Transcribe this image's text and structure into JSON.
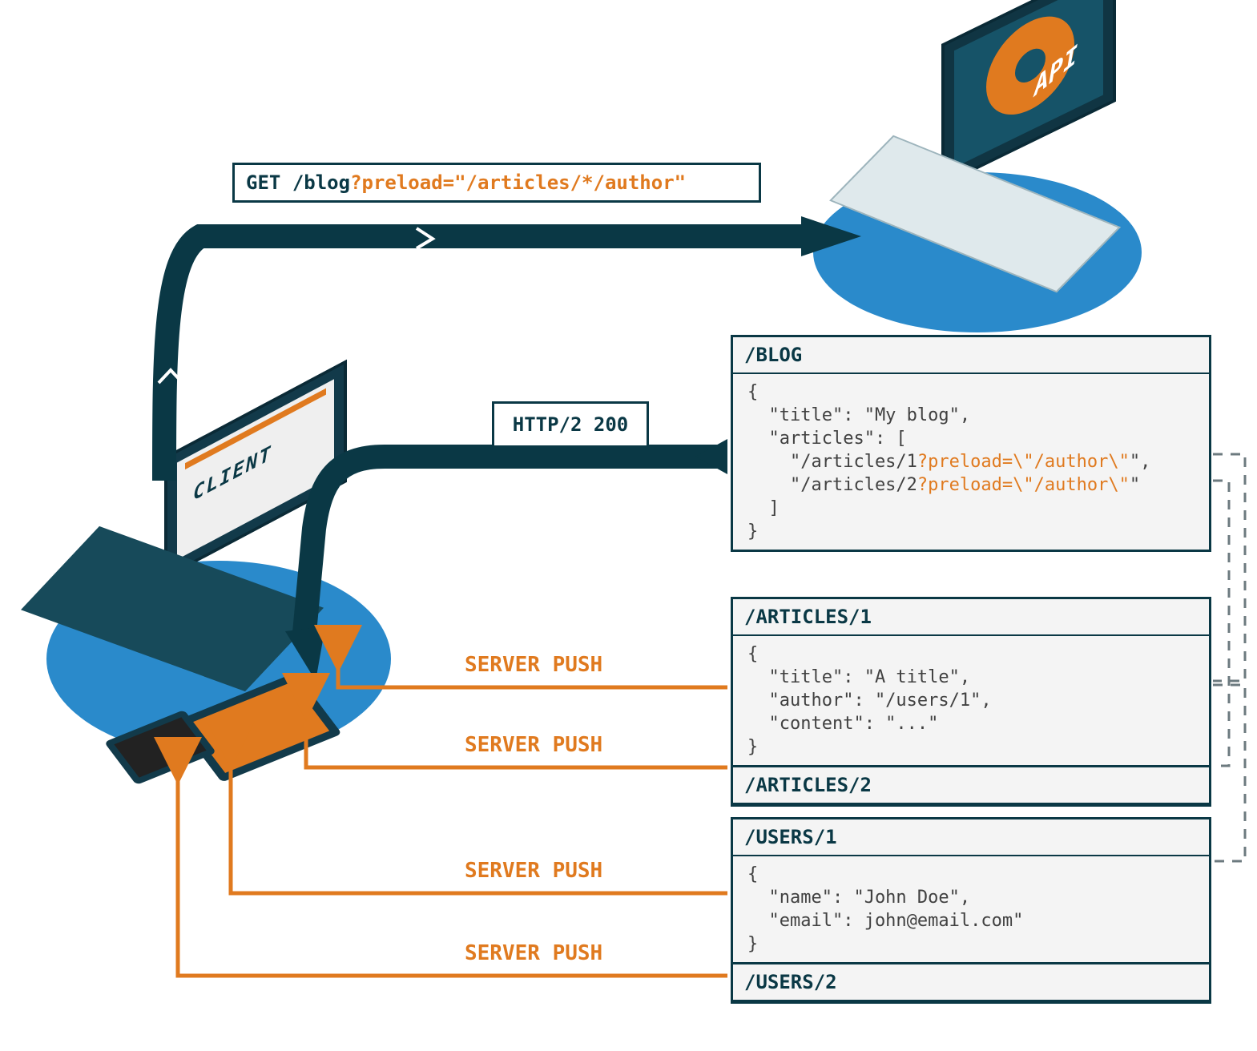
{
  "colors": {
    "accent": "#e07a1f",
    "ink": "#0a3845",
    "platform": "#2a8acb"
  },
  "client": {
    "label": "CLIENT"
  },
  "api": {
    "label": "API"
  },
  "request": {
    "method": "GET",
    "path_plain": "/blog",
    "path_query": "?preload=\"/articles/*/author\""
  },
  "http_status": "HTTP/2 200",
  "push_label": "SERVER PUSH",
  "responses": {
    "blog": {
      "title": "/BLOG",
      "line1": "{",
      "line2": "  \"title\": \"My blog\",",
      "line3": "  \"articles\": [",
      "line4a": "    \"/articles/1",
      "line4b": "?preload=\\\"/author\\\"",
      "line4c": "\",",
      "line5a": "    \"/articles/2",
      "line5b": "?preload=\\\"/author\\\"",
      "line5c": "\"",
      "line6": "  ]",
      "line7": "}"
    },
    "article1": {
      "title": "/ARTICLES/1",
      "line1": "{",
      "line2": "  \"title\": \"A title\",",
      "line3": "  \"author\": \"/users/1\",",
      "line4": "  \"content\": \"...\"",
      "line5": "}"
    },
    "article2": {
      "title": "/ARTICLES/2"
    },
    "user1": {
      "title": "/USERS/1",
      "line1": "{",
      "line2": "  \"name\": \"John Doe\",",
      "line3": "  \"email\": john@email.com\"",
      "line4": "}"
    },
    "user2": {
      "title": "/USERS/2"
    }
  }
}
